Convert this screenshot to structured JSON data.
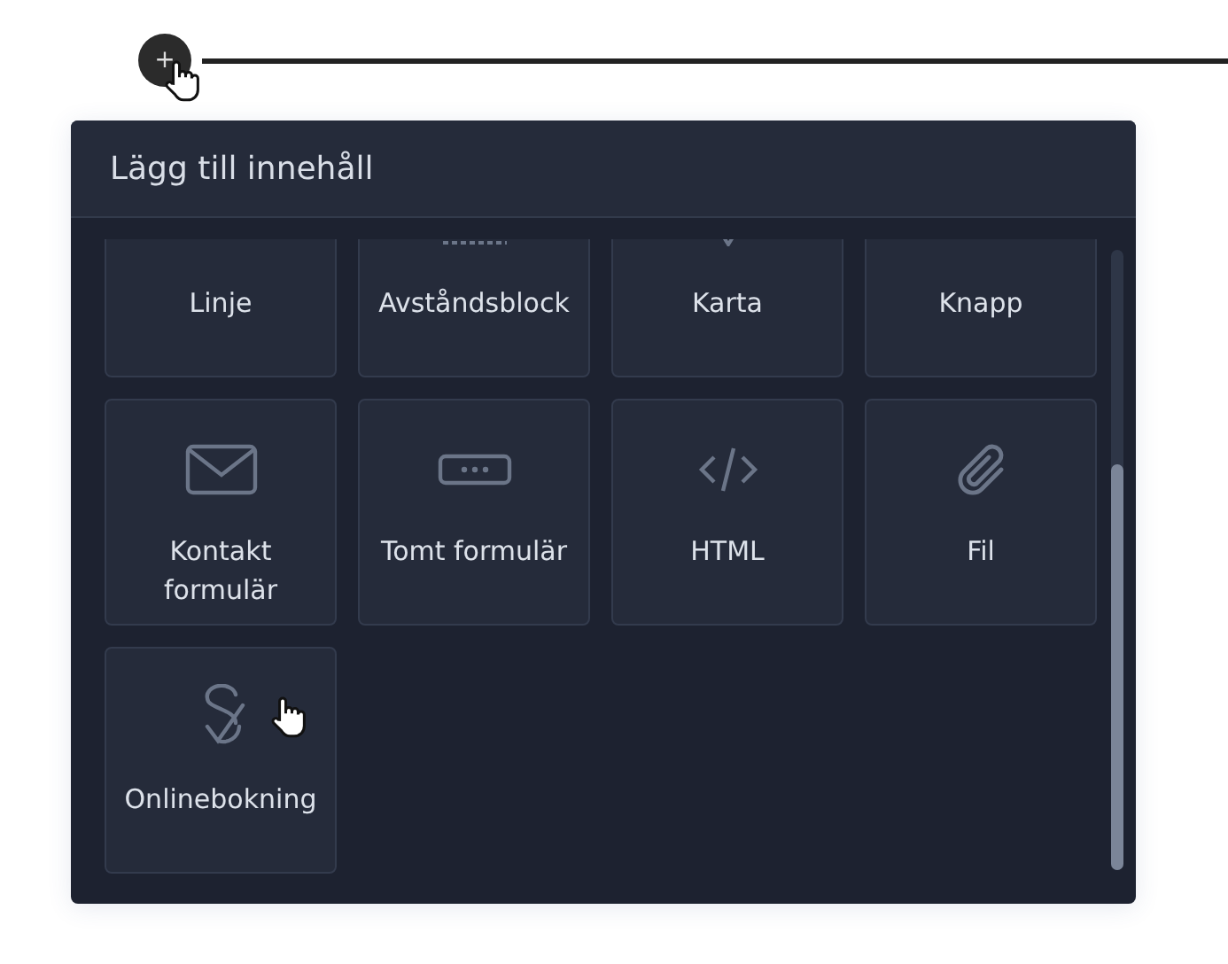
{
  "add_button": {
    "label": "+"
  },
  "panel": {
    "title": "Lägg till innehåll"
  },
  "tiles": [
    {
      "label": "Linje",
      "kind": "line"
    },
    {
      "label": "Avståndsblock",
      "kind": "spacer"
    },
    {
      "label": "Karta",
      "kind": "map"
    },
    {
      "label": "Knapp",
      "kind": "button"
    },
    {
      "label": "Kontakt formulär",
      "kind": "mail"
    },
    {
      "label": "Tomt formulär",
      "kind": "field"
    },
    {
      "label": "HTML",
      "kind": "code"
    },
    {
      "label": "Fil",
      "kind": "clip"
    },
    {
      "label": "Onlinebokning",
      "kind": "booking"
    }
  ]
}
